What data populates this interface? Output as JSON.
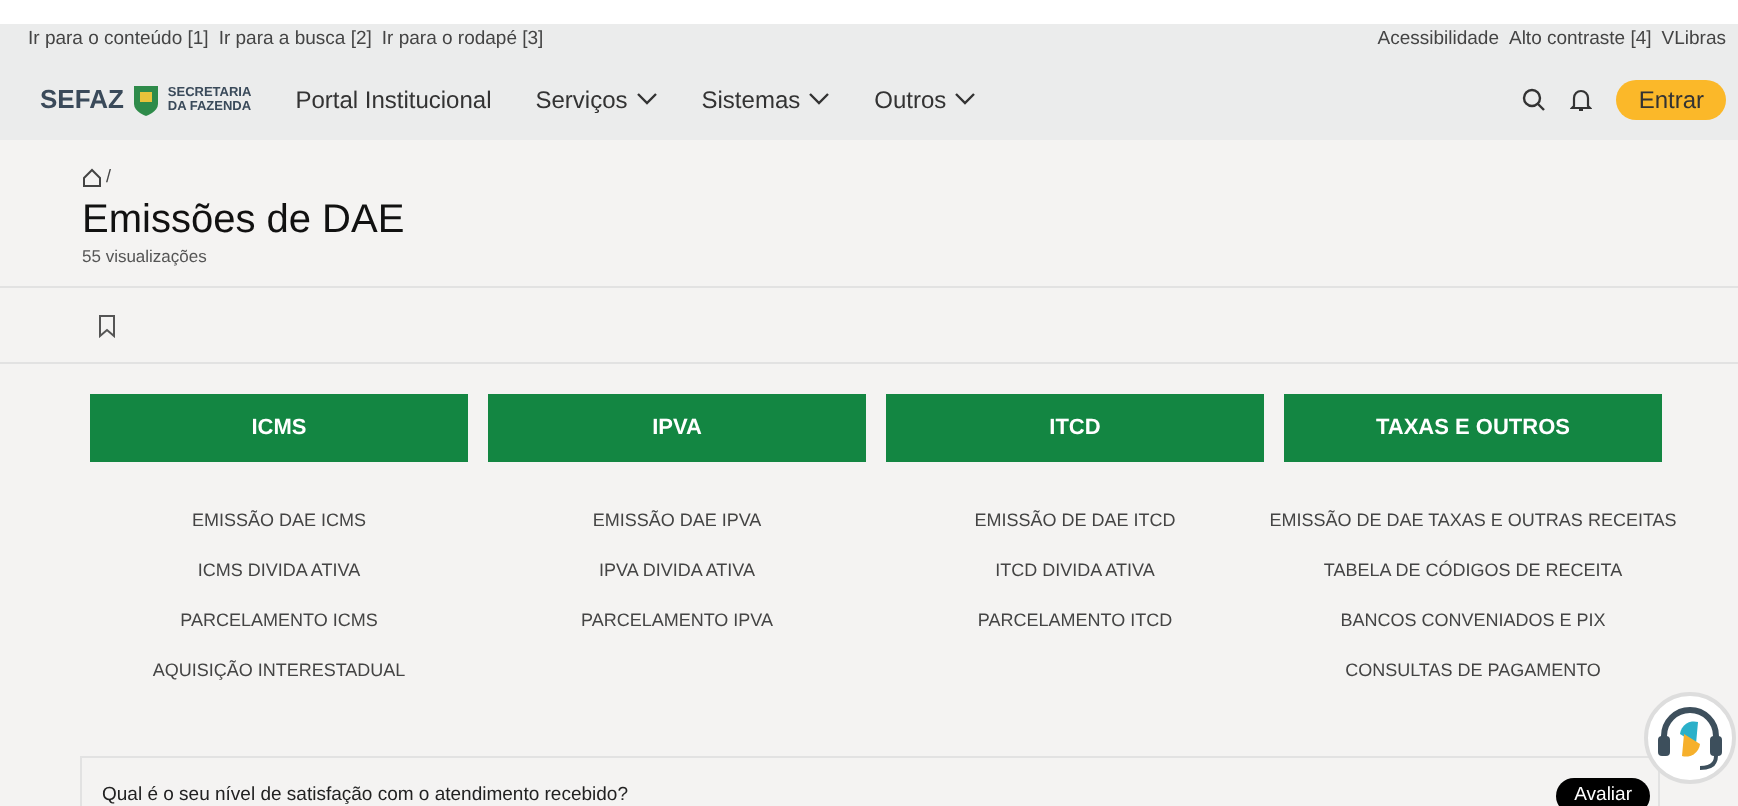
{
  "skip_links": [
    "Ir para o conteúdo [1]",
    "Ir para a busca [2]",
    "Ir para o rodapé [3]"
  ],
  "accessibility_links": [
    "Acessibilidade",
    "Alto contraste [4]",
    "VLibras"
  ],
  "logo": {
    "brand": "SEFAZ",
    "line1": "SECRETARIA",
    "line2": "DA FAZENDA"
  },
  "nav": [
    {
      "label": "Portal Institucional",
      "dropdown": false
    },
    {
      "label": "Serviços",
      "dropdown": true
    },
    {
      "label": "Sistemas",
      "dropdown": true
    },
    {
      "label": "Outros",
      "dropdown": true
    }
  ],
  "login_button": "Entrar",
  "breadcrumb_separator": "/",
  "title": "Emissões de DAE",
  "views": "55 visualizações",
  "categories": [
    {
      "title": "ICMS",
      "links": [
        "EMISSÃO DAE ICMS",
        "ICMS DIVIDA ATIVA",
        "PARCELAMENTO ICMS",
        "AQUISIÇÃO INTERESTADUAL"
      ]
    },
    {
      "title": "IPVA",
      "links": [
        "EMISSÃO DAE IPVA",
        "IPVA DIVIDA ATIVA",
        "PARCELAMENTO IPVA"
      ]
    },
    {
      "title": "ITCD",
      "links": [
        "EMISSÃO DE DAE ITCD",
        "ITCD DIVIDA ATIVA",
        "PARCELAMENTO ITCD"
      ]
    },
    {
      "title": "TAXAS E OUTROS",
      "links": [
        "EMISSÃO DE DAE TAXAS E OUTRAS RECEITAS",
        "TABELA DE CÓDIGOS DE RECEITA",
        "BANCOS CONVENIADOS E PIX",
        "CONSULTAS DE PAGAMENTO"
      ]
    }
  ],
  "satisfaction": {
    "question": "Qual é o seu nível de satisfação com o atendimento recebido?",
    "button": "Avaliar"
  }
}
